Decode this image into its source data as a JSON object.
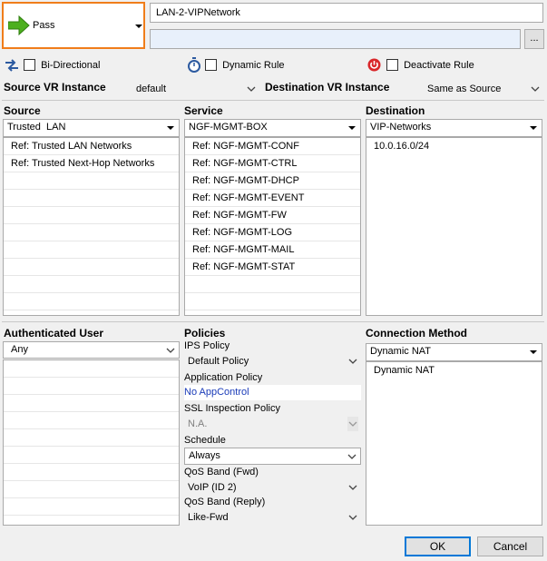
{
  "action": {
    "label": "Pass",
    "icon": "green-arrow-right-icon"
  },
  "rule_name": "LAN-2-VIPNetwork",
  "rule_description": "",
  "more_button_label": "...",
  "options": {
    "bidirectional": {
      "label": "Bi-Directional",
      "checked": false,
      "icon": "bidirectional-arrows-icon"
    },
    "dynamic_rule": {
      "label": "Dynamic Rule",
      "checked": false,
      "icon": "stopwatch-icon"
    },
    "deactivate_rule": {
      "label": "Deactivate Rule",
      "checked": false,
      "icon": "power-icon"
    }
  },
  "vr_instance": {
    "source_label": "Source VR Instance",
    "source_value": "default",
    "destination_label": "Destination VR Instance",
    "destination_value": "Same as Source"
  },
  "source": {
    "label": "Source",
    "selected": "Trusted  LAN",
    "items": [
      "Ref: Trusted LAN Networks",
      "Ref: Trusted Next-Hop Networks"
    ]
  },
  "service": {
    "label": "Service",
    "selected": "NGF-MGMT-BOX",
    "items": [
      "Ref: NGF-MGMT-CONF",
      "Ref: NGF-MGMT-CTRL",
      "Ref: NGF-MGMT-DHCP",
      "Ref: NGF-MGMT-EVENT",
      "Ref: NGF-MGMT-FW",
      "Ref: NGF-MGMT-LOG",
      "Ref: NGF-MGMT-MAIL",
      "Ref: NGF-MGMT-STAT"
    ]
  },
  "destination": {
    "label": "Destination",
    "selected": "VIP-Networks",
    "items": [
      "10.0.16.0/24"
    ]
  },
  "authenticated_user": {
    "label": "Authenticated User",
    "selected": "Any"
  },
  "policies": {
    "label": "Policies",
    "ips_label": "IPS Policy",
    "ips_value": "Default Policy",
    "app_label": "Application Policy",
    "app_value": "No AppControl",
    "ssl_label": "SSL Inspection Policy",
    "ssl_value": "N.A.",
    "schedule_label": "Schedule",
    "schedule_value": "Always",
    "qos_fwd_label": "QoS Band (Fwd)",
    "qos_fwd_value": "VoIP (ID 2)",
    "qos_reply_label": "QoS Band (Reply)",
    "qos_reply_value": "Like-Fwd"
  },
  "connection_method": {
    "label": "Connection Method",
    "selected": "Dynamic NAT",
    "items": [
      "Dynamic NAT"
    ]
  },
  "buttons": {
    "ok": "OK",
    "cancel": "Cancel"
  },
  "colors": {
    "highlight_border": "#f07d1a",
    "action_arrow": "#4caf1e",
    "power_icon": "#d9262a",
    "link": "#1a3bb8"
  }
}
